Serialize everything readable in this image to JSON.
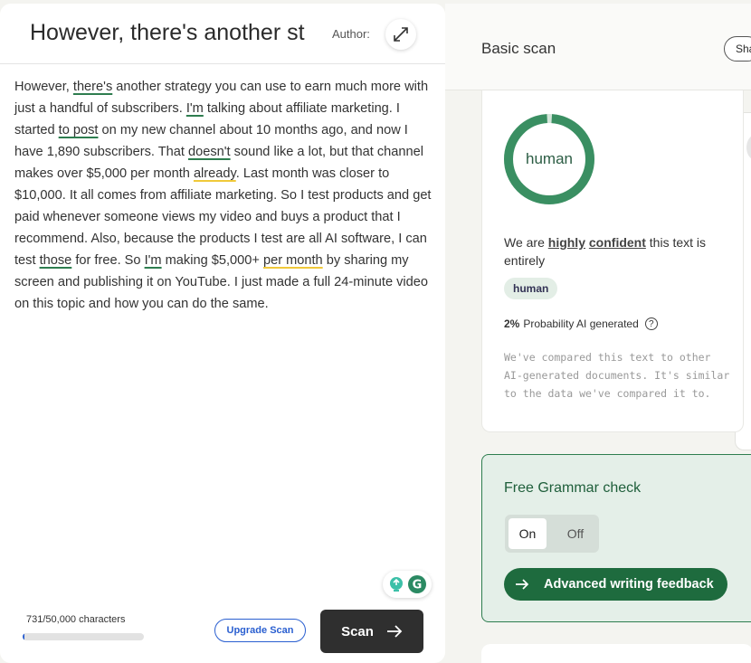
{
  "editor": {
    "title": "However, there's another st",
    "author_label": "Author:",
    "paragraph": [
      {
        "text": "However, ",
        "mark": ""
      },
      {
        "text": "there's",
        "mark": "green"
      },
      {
        "text": " another strategy you can use to earn much more with just a handful of subscribers. ",
        "mark": ""
      },
      {
        "text": "I'm",
        "mark": "green"
      },
      {
        "text": " talking about affiliate marketing. I started ",
        "mark": ""
      },
      {
        "text": "to post",
        "mark": "green"
      },
      {
        "text": " on my new channel about 10 months ago, and now I have 1,890 subscribers. That ",
        "mark": ""
      },
      {
        "text": "doesn't",
        "mark": "green"
      },
      {
        "text": " sound like a lot, but that channel makes over $5,000 per month ",
        "mark": ""
      },
      {
        "text": "already",
        "mark": "yellow"
      },
      {
        "text": ". Last month was closer to $10,000. It all comes from affiliate marketing. So I test products and get paid whenever someone views my video and buys a product that I recommend. Also, because the products I test are all AI software, I can test ",
        "mark": ""
      },
      {
        "text": "those",
        "mark": "green"
      },
      {
        "text": " for free. So ",
        "mark": ""
      },
      {
        "text": "I'm",
        "mark": "green"
      },
      {
        "text": " making $5,000+ ",
        "mark": ""
      },
      {
        "text": "per month",
        "mark": "yellow"
      },
      {
        "text": " by sharing my screen and publishing it on YouTube. I just made a full 24-minute video on this topic and how you can do the same.",
        "mark": ""
      }
    ],
    "char_count": "731/50,000 characters",
    "char_progress": 0.015,
    "upgrade_label": "Upgrade Scan",
    "scan_label": "Scan"
  },
  "panel": {
    "header_title": "Basic scan",
    "share_label": "Share",
    "result": {
      "donut_label": "human",
      "human_fraction": 0.98,
      "confidence_prefix": "We are ",
      "confidence_word1": "highly",
      "confidence_word2": "confident",
      "confidence_suffix": " this text is entirely",
      "badge": "human",
      "prob_value": "2%",
      "prob_text": "Probability AI generated",
      "help": "?",
      "note": "We've compared this text to other AI-generated documents. It's similar to the data we've compared it to."
    },
    "grammar": {
      "title": "Free Grammar check",
      "toggle_on": "On",
      "toggle_off": "Off",
      "advanced_label": "Advanced writing feedback"
    }
  },
  "colors": {
    "accent_green": "#2e7d4f",
    "donut_green": "#3a8f62",
    "highlight_yellow": "#f0c93a",
    "link_blue": "#2a5fd0",
    "dark_button": "#2f2f2f"
  }
}
